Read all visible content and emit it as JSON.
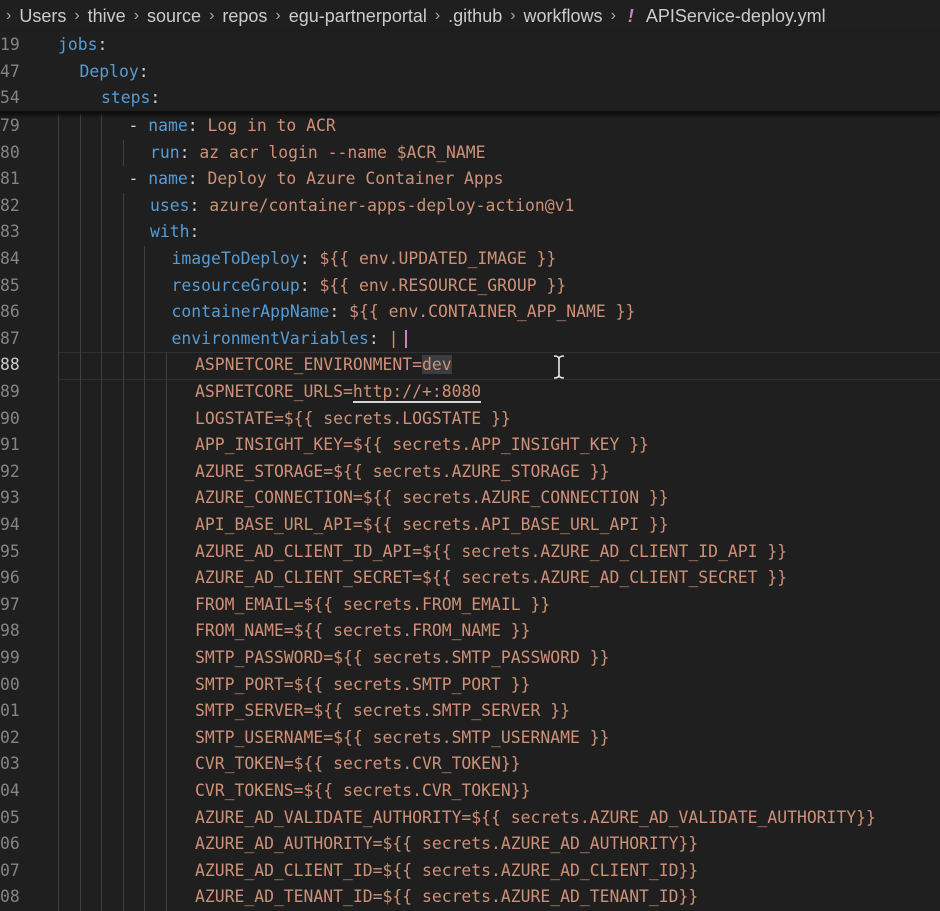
{
  "breadcrumb": {
    "segments": [
      "Users",
      "thive",
      "source",
      "repos",
      "egu-partnerportal",
      ".github",
      "workflows"
    ],
    "file_icon": "!",
    "file": "APIService-deploy.yml"
  },
  "sticky_lines": [
    {
      "num": "19",
      "key": "jobs",
      "indent": 0
    },
    {
      "num": "47",
      "key": "Deploy",
      "indent": 1
    },
    {
      "num": "54",
      "key": "steps",
      "indent": 2
    }
  ],
  "lines": [
    {
      "num": "79",
      "indent": 3,
      "dash": true,
      "key": "name",
      "value": "Log in to ACR"
    },
    {
      "num": "80",
      "indent": 4,
      "dash": false,
      "key": "run",
      "value": "az acr login --name $ACR_NAME"
    },
    {
      "num": "81",
      "indent": 3,
      "dash": true,
      "key": "name",
      "value": "Deploy to Azure Container Apps"
    },
    {
      "num": "82",
      "indent": 4,
      "dash": false,
      "key": "uses",
      "value": "azure/container-apps-deploy-action@v1"
    },
    {
      "num": "83",
      "indent": 4,
      "dash": false,
      "key": "with",
      "value": ""
    },
    {
      "num": "84",
      "indent": 5,
      "dash": false,
      "key": "imageToDeploy",
      "value": "${{ env.UPDATED_IMAGE }}"
    },
    {
      "num": "85",
      "indent": 5,
      "dash": false,
      "key": "resourceGroup",
      "value": "${{ env.RESOURCE_GROUP }}"
    },
    {
      "num": "86",
      "indent": 5,
      "dash": false,
      "key": "containerAppName",
      "value": "${{ env.CONTAINER_APP_NAME }}"
    },
    {
      "num": "87",
      "indent": 5,
      "dash": false,
      "key": "environmentVariables",
      "value": "|"
    },
    {
      "num": "88",
      "indent": 6,
      "text": "ASPNETCORE_ENVIRONMENT=",
      "hl": "dev",
      "active": true
    },
    {
      "num": "89",
      "indent": 6,
      "text": "ASPNETCORE_URLS=",
      "ul": "http://+:8080"
    },
    {
      "num": "90",
      "indent": 6,
      "text": "LOGSTATE=${{ secrets.LOGSTATE }}"
    },
    {
      "num": "91",
      "indent": 6,
      "text": "APP_INSIGHT_KEY=${{ secrets.APP_INSIGHT_KEY }}"
    },
    {
      "num": "92",
      "indent": 6,
      "text": "AZURE_STORAGE=${{ secrets.AZURE_STORAGE }}"
    },
    {
      "num": "93",
      "indent": 6,
      "text": "AZURE_CONNECTION=${{ secrets.AZURE_CONNECTION }}"
    },
    {
      "num": "94",
      "indent": 6,
      "text": "API_BASE_URL_API=${{ secrets.API_BASE_URL_API }}"
    },
    {
      "num": "95",
      "indent": 6,
      "text": "AZURE_AD_CLIENT_ID_API=${{ secrets.AZURE_AD_CLIENT_ID_API }}"
    },
    {
      "num": "96",
      "indent": 6,
      "text": "AZURE_AD_CLIENT_SECRET=${{ secrets.AZURE_AD_CLIENT_SECRET }}"
    },
    {
      "num": "97",
      "indent": 6,
      "text": "FROM_EMAIL=${{ secrets.FROM_EMAIL }}"
    },
    {
      "num": "98",
      "indent": 6,
      "text": "FROM_NAME=${{ secrets.FROM_NAME }}"
    },
    {
      "num": "99",
      "indent": 6,
      "text": "SMTP_PASSWORD=${{ secrets.SMTP_PASSWORD }}"
    },
    {
      "num": "00",
      "indent": 6,
      "text": "SMTP_PORT=${{ secrets.SMTP_PORT }}"
    },
    {
      "num": "01",
      "indent": 6,
      "text": "SMTP_SERVER=${{ secrets.SMTP_SERVER }}"
    },
    {
      "num": "02",
      "indent": 6,
      "text": "SMTP_USERNAME=${{ secrets.SMTP_USERNAME }}"
    },
    {
      "num": "03",
      "indent": 6,
      "text": "CVR_TOKEN=${{ secrets.CVR_TOKEN}}"
    },
    {
      "num": "04",
      "indent": 6,
      "text": "CVR_TOKENS=${{ secrets.CVR_TOKEN}}"
    },
    {
      "num": "05",
      "indent": 6,
      "text": "AZURE_AD_VALIDATE_AUTHORITY=${{ secrets.AZURE_AD_VALIDATE_AUTHORITY}}"
    },
    {
      "num": "06",
      "indent": 6,
      "text": "AZURE_AD_AUTHORITY=${{ secrets.AZURE_AD_AUTHORITY}}"
    },
    {
      "num": "07",
      "indent": 6,
      "text": "AZURE_AD_CLIENT_ID=${{ secrets.AZURE_AD_CLIENT_ID}}"
    },
    {
      "num": "08",
      "indent": 6,
      "text": "AZURE_AD_TENANT_ID=${{ secrets.AZURE_AD_TENANT_ID}}"
    }
  ],
  "colors": {
    "background": "#1f1f1f",
    "key": "#569cd6",
    "string": "#ce9178",
    "punctuation": "#d4d4d4",
    "line_number": "#858585",
    "yaml_icon": "#c586c0"
  }
}
